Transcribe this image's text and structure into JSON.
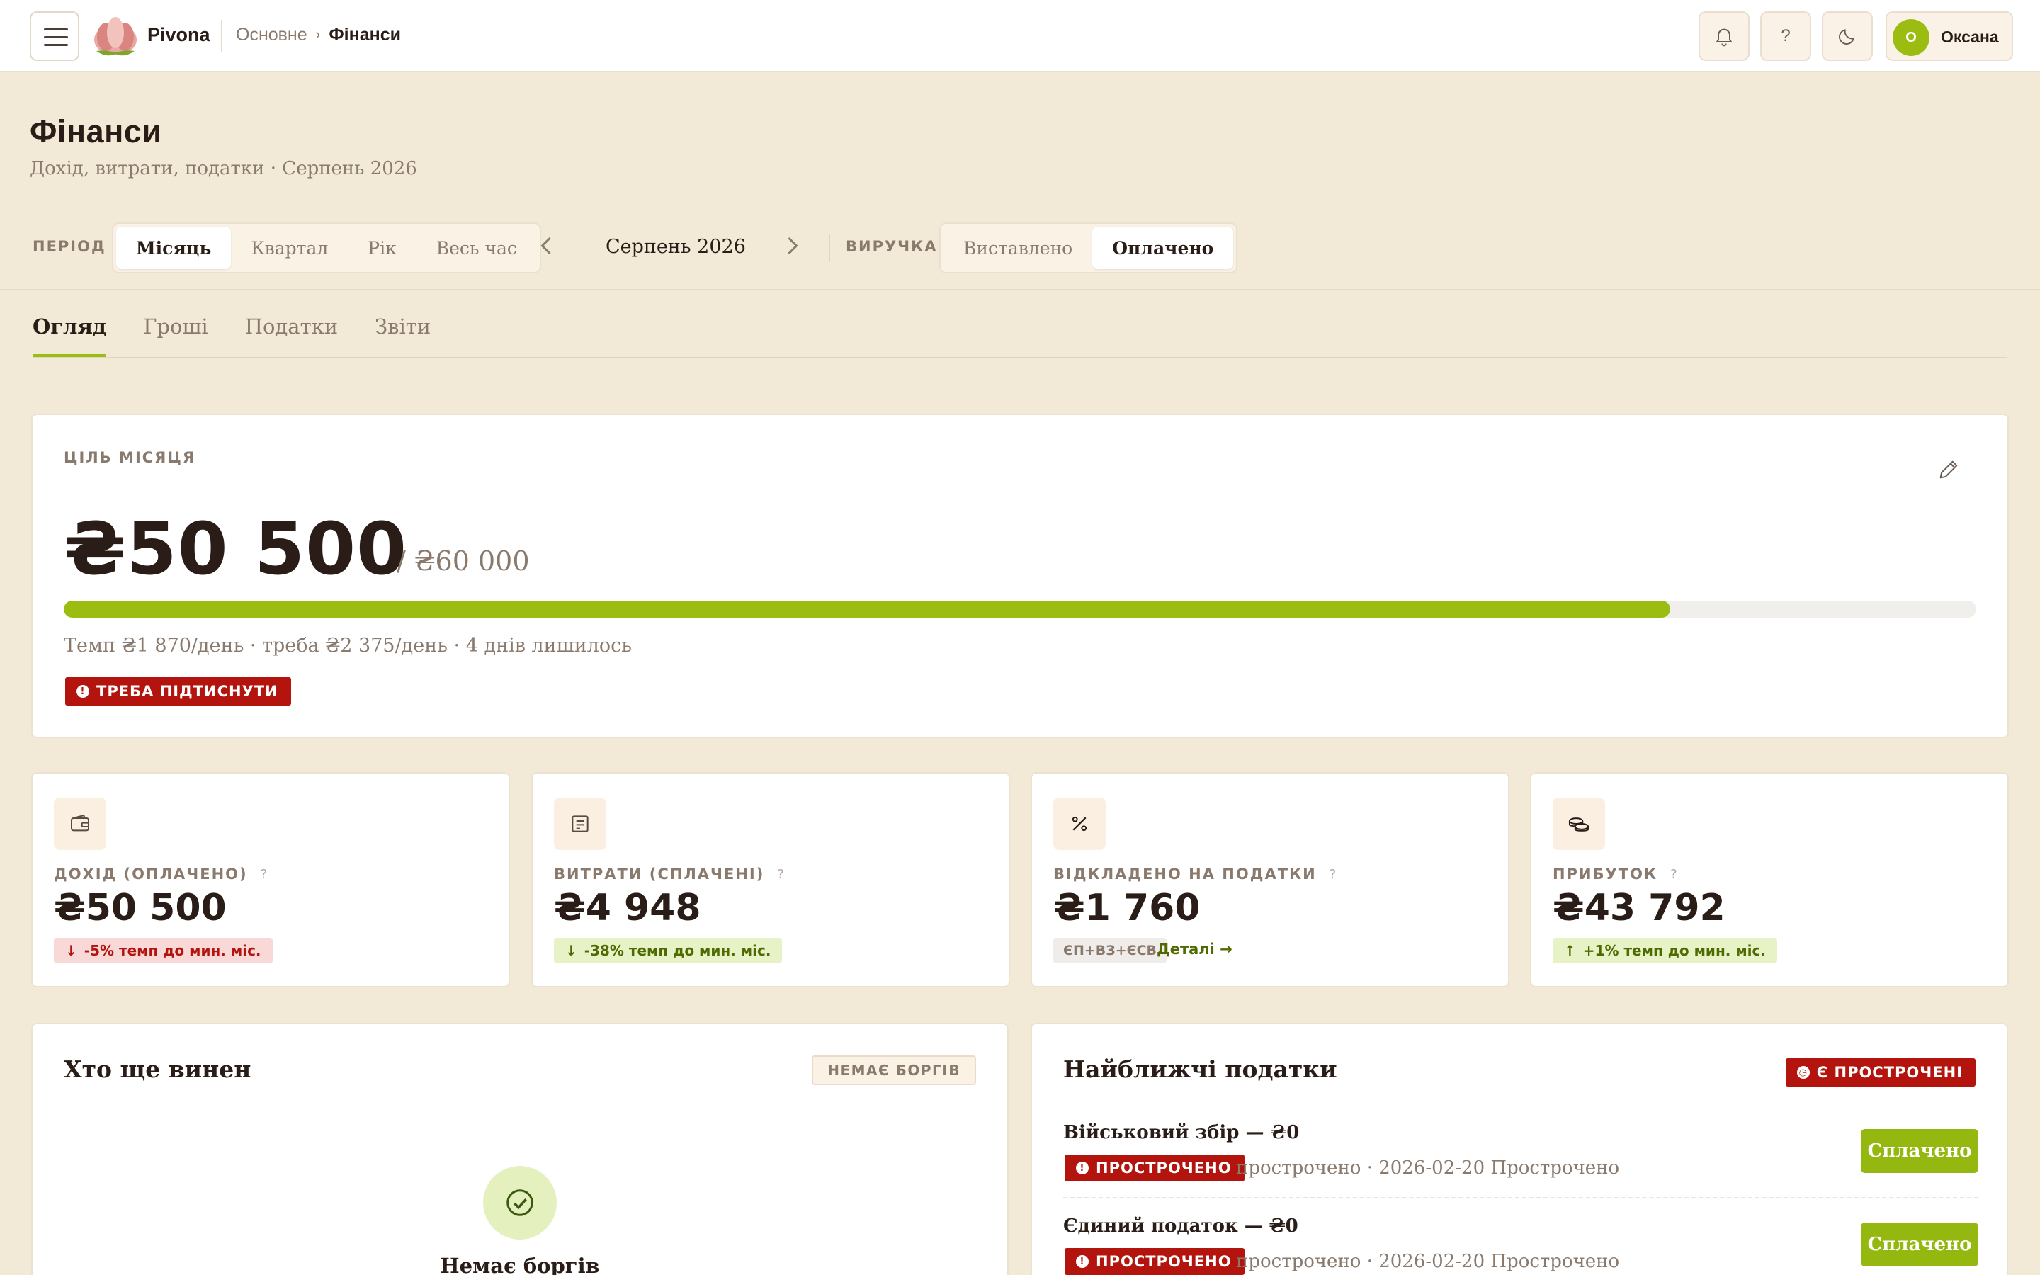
{
  "app": {
    "name": "Pivona"
  },
  "breadcrumb": {
    "parent": "Основне",
    "separator": "›",
    "current": "Фінанси"
  },
  "header": {
    "user_initial": "О",
    "user_name": "Оксана"
  },
  "page": {
    "title": "Фінанси",
    "subtitle": "Дохід, витрати, податки · Серпень 2026"
  },
  "filters": {
    "period_label": "ПЕРІОД",
    "period_options": [
      "Місяць",
      "Квартал",
      "Рік",
      "Весь час"
    ],
    "period_selected": "Місяць",
    "current_period": "Серпень 2026",
    "revenue_label": "ВИРУЧКА",
    "revenue_options": [
      "Виставлено",
      "Оплачено"
    ],
    "revenue_selected": "Оплачено"
  },
  "tabs": [
    "Огляд",
    "Гроші",
    "Податки",
    "Звіти"
  ],
  "tabs_active": "Огляд",
  "goal": {
    "caption": "ЦІЛЬ МІСЯЦЯ",
    "value": "₴50 500",
    "target": "/ ₴60 000",
    "progress": 0.84,
    "meta": "Темп ₴1 870/день · треба ₴2 375/день · 4 днів лишилось",
    "alert": "ТРЕБА ПІДТИСНУТИ"
  },
  "stats": [
    {
      "caption": "ДОХІД (ОПЛАЧЕНО)",
      "help": "?",
      "value": "₴50 500",
      "chip": "-5% темп до мин. міс.",
      "chip_arrow": "↓",
      "tone": "red",
      "icon": "wallet-icon"
    },
    {
      "caption": "ВИТРАТИ (СПЛАЧЕНІ)",
      "help": "?",
      "value": "₴4 948",
      "chip": "-38% темп до мин. міс.",
      "chip_arrow": "↓",
      "tone": "green",
      "icon": "receipt-icon"
    },
    {
      "caption": "ВІДКЛАДЕНО НА ПОДАТКИ",
      "help": "?",
      "value": "₴1 760",
      "chip": "ЄП+ВЗ+ЄСВ",
      "link": "Деталі →",
      "tone": "grey",
      "icon": "percent-icon"
    },
    {
      "caption": "ПРИБУТОК",
      "help": "?",
      "value": "₴43 792",
      "chip": "+1% темп до мин. міс.",
      "chip_arrow": "↑",
      "tone": "green",
      "icon": "coins-icon"
    }
  ],
  "debts": {
    "title": "Хто ще винен",
    "badge": "НЕМАЄ БОРГІВ",
    "empty_title": "Немає боргів"
  },
  "taxes": {
    "title": "Найближчі податки",
    "badge": "Є ПРОСТРОЧЕНІ",
    "items": [
      {
        "name": "Військовий збір — ₴0",
        "status": "ПРОСТРОЧЕНО",
        "meta": "прострочено · 2026-02-20  Прострочено",
        "action": "Сплачено"
      },
      {
        "name": "Єдиний податок — ₴0",
        "status": "ПРОСТРОЧЕНО",
        "meta": "прострочено · 2026-02-20  Прострочено",
        "action": "Сплачено"
      }
    ]
  },
  "colors": {
    "accent": "#9bbd12",
    "danger": "#b3150e",
    "background": "#f2e9d6",
    "muted": "#8a7a6e"
  }
}
